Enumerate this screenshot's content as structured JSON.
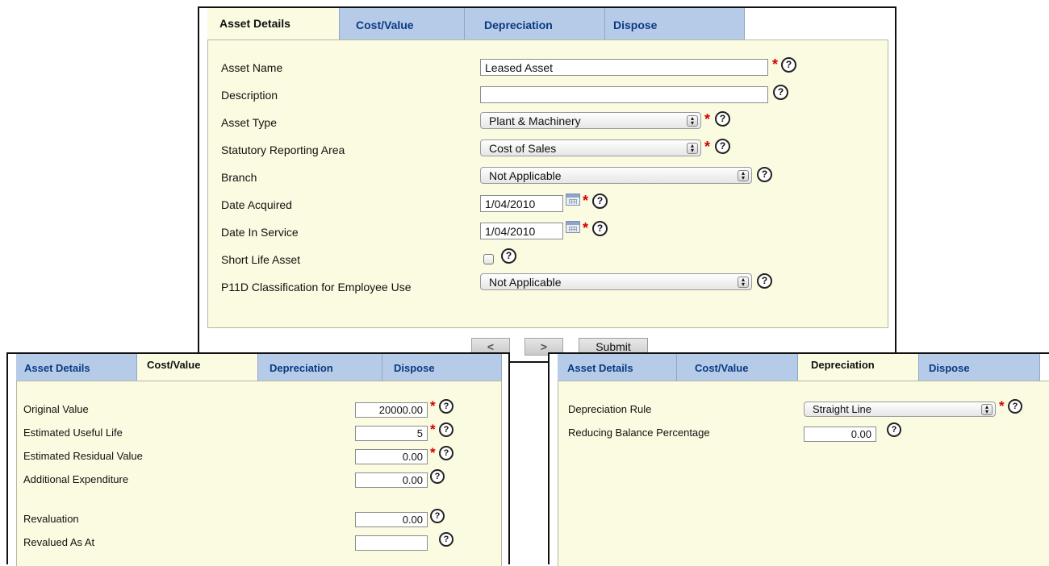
{
  "tabs": [
    "Asset Details",
    "Cost/Value",
    "Depreciation",
    "Dispose"
  ],
  "main": {
    "fields": [
      {
        "label": "Asset Name",
        "value": "Leased Asset"
      },
      {
        "label": "Description",
        "value": ""
      },
      {
        "label": "Asset Type",
        "value": "Plant & Machinery"
      },
      {
        "label": "Statutory Reporting Area",
        "value": "Cost of Sales"
      },
      {
        "label": "Branch",
        "value": "Not Applicable"
      },
      {
        "label": "Date Acquired",
        "value": "1/04/2010"
      },
      {
        "label": "Date In Service",
        "value": "1/04/2010"
      },
      {
        "label": "Short Life Asset",
        "value": ""
      },
      {
        "label": "P11D Classification for Employee Use",
        "value": "Not Applicable"
      }
    ],
    "nav": {
      "prev": "<",
      "next": ">",
      "submit": "Submit"
    }
  },
  "cost": {
    "fields": [
      {
        "label": "Original Value",
        "value": "20000.00"
      },
      {
        "label": "Estimated Useful Life",
        "value": "5"
      },
      {
        "label": "Estimated Residual Value",
        "value": "0.00"
      },
      {
        "label": "Additional Expenditure",
        "value": "0.00"
      },
      {
        "label": "Revaluation",
        "value": "0.00"
      },
      {
        "label": "Revalued As At",
        "value": ""
      }
    ]
  },
  "depreciation": {
    "fields": [
      {
        "label": "Depreciation Rule",
        "value": "Straight Line"
      },
      {
        "label": "Reducing Balance Percentage",
        "value": "0.00"
      }
    ]
  },
  "symbols": {
    "required": "*",
    "help": "?"
  },
  "colors": {
    "tab_bg": "#b6cbe8",
    "tab_text": "#0b3a82",
    "panel_bg": "#fbfbe1",
    "required": "#d40000"
  }
}
